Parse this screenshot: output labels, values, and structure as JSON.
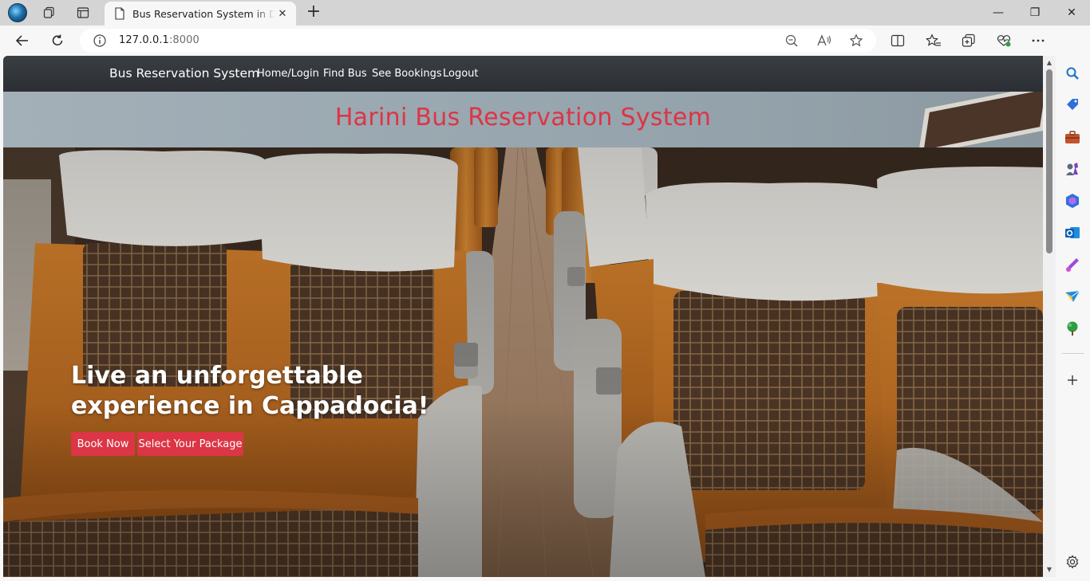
{
  "browser": {
    "tab_title": "Bus Reservation System in Django",
    "address_host": "127.0.0.1",
    "address_port": ":8000",
    "tab_close": "✕",
    "new_tab": "+",
    "window_minimize": "—",
    "window_restore": "❐",
    "window_close": "✕"
  },
  "navbar": {
    "brand": "Bus Reservation System",
    "links": [
      "Home/Login",
      "Find Bus",
      "See Bookings",
      "Logout"
    ]
  },
  "banner": {
    "title": "Harini Bus Reservation System"
  },
  "hero": {
    "heading": "Live an unforgettable experience in Cappadocia!",
    "buttons": [
      "Book Now",
      "Select Your Package"
    ]
  },
  "colors": {
    "accent": "#dc3545",
    "navbar": "#343a40",
    "leather": "#b86a1f"
  },
  "icons": [
    "back-icon",
    "refresh-icon",
    "info-icon",
    "zoom-out-icon",
    "read-aloud-icon",
    "favorite-icon",
    "split-screen-icon",
    "favorites-icon",
    "collections-icon",
    "performance-icon",
    "more-icon",
    "copilot-icon",
    "search-icon",
    "shopping-icon",
    "tools-icon",
    "games-icon",
    "microsoft365-icon",
    "outlook-icon",
    "designer-icon",
    "drop-icon",
    "tree-icon",
    "add-icon",
    "settings-icon"
  ]
}
